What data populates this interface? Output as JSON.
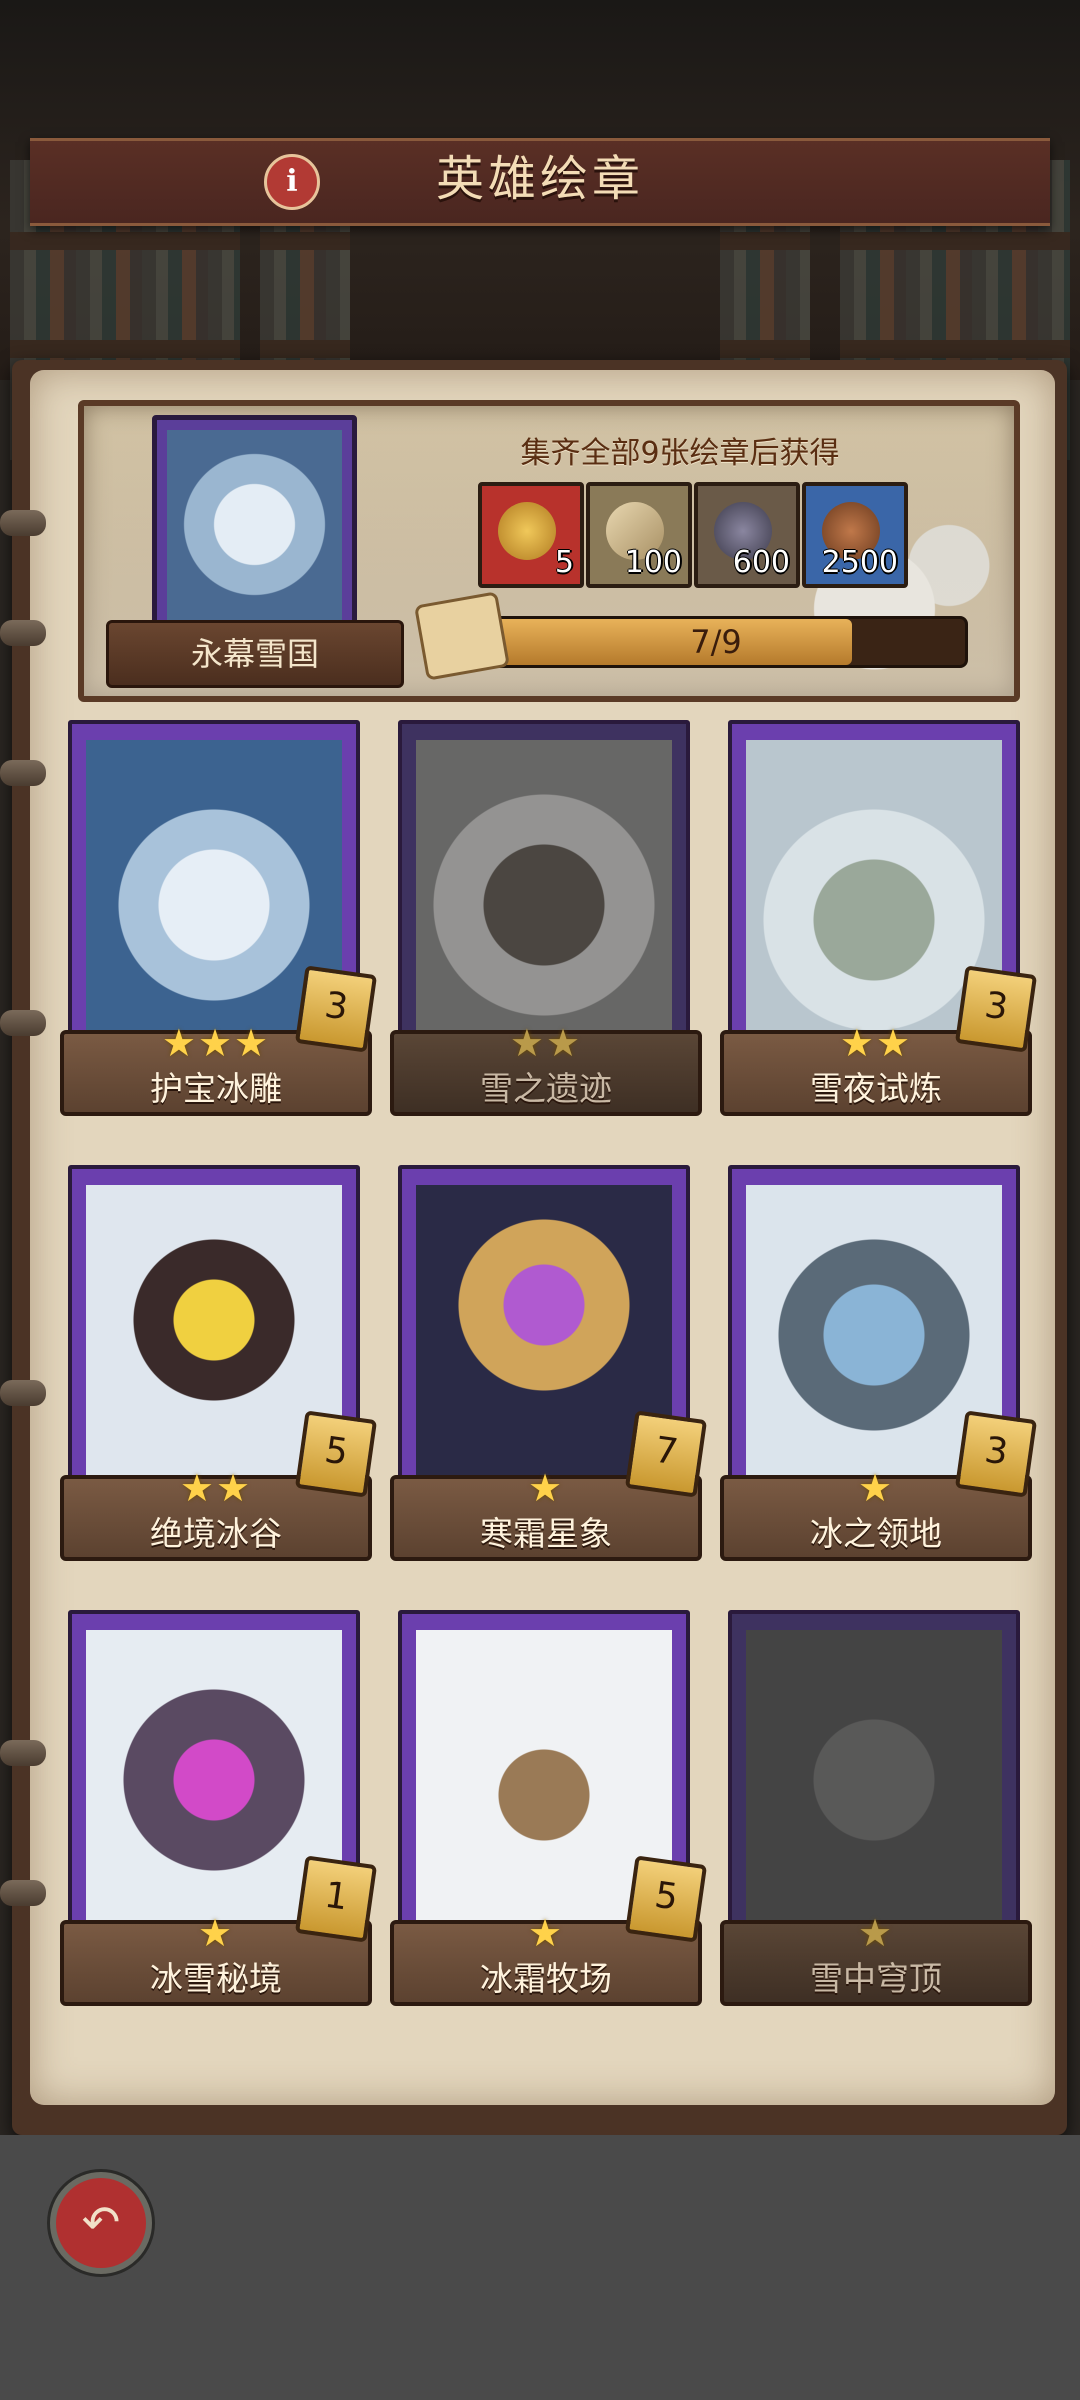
{
  "header": {
    "title": "英雄绘章",
    "info_glyph": "i"
  },
  "collection": {
    "name": "永幕雪国",
    "hint": "集齐全部9张绘章后获得",
    "rewards": [
      {
        "icon": "hero-chest-icon",
        "count": "5",
        "color": "#b8322c"
      },
      {
        "icon": "scroll-icon",
        "count": "100",
        "color": "#8a7a58"
      },
      {
        "icon": "ore-icon",
        "count": "600",
        "color": "#6a5a48"
      },
      {
        "icon": "copper-ore-icon",
        "count": "2500",
        "color": "#3a66a8"
      }
    ],
    "progress": {
      "text": "7/9",
      "value": 0.78
    }
  },
  "cards": [
    {
      "name": "护宝冰雕",
      "stars": "★★★",
      "badge": "3",
      "unlocked": true
    },
    {
      "name": "雪之遗迹",
      "stars": "★★",
      "badge": "",
      "unlocked": false
    },
    {
      "name": "雪夜试炼",
      "stars": "★★",
      "badge": "3",
      "unlocked": true
    },
    {
      "name": "绝境冰谷",
      "stars": "★★",
      "badge": "5",
      "unlocked": true
    },
    {
      "name": "寒霜星象",
      "stars": "★",
      "badge": "7",
      "unlocked": true
    },
    {
      "name": "冰之领地",
      "stars": "★",
      "badge": "3",
      "unlocked": true
    },
    {
      "name": "冰雪秘境",
      "stars": "★",
      "badge": "1",
      "unlocked": true
    },
    {
      "name": "冰霜牧场",
      "stars": "★",
      "badge": "5",
      "unlocked": true
    },
    {
      "name": "雪中穹顶",
      "stars": "★",
      "badge": "",
      "unlocked": false
    }
  ],
  "footer": {
    "back_glyph": "↶"
  }
}
